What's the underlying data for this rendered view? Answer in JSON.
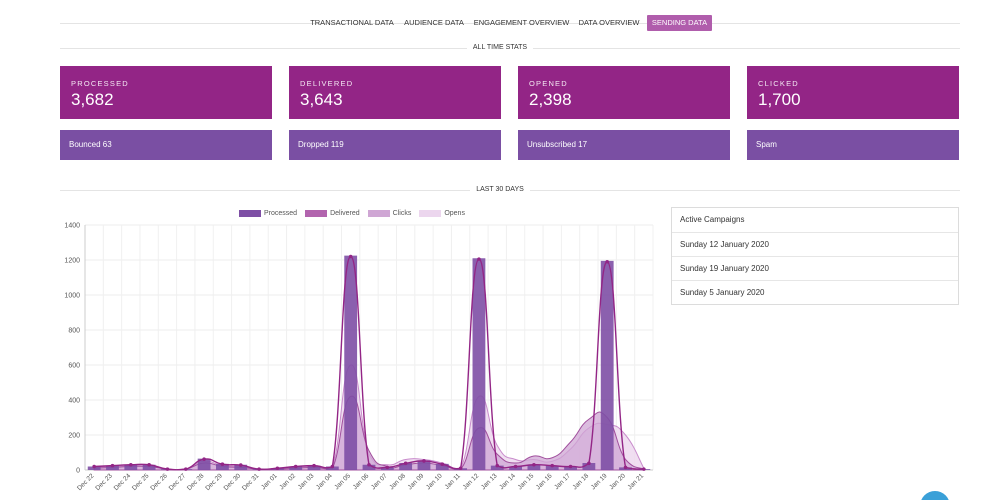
{
  "tabs": [
    {
      "label": "Transactional Data"
    },
    {
      "label": "Audience Data"
    },
    {
      "label": "Engagement Overview"
    },
    {
      "label": "Data Overview"
    },
    {
      "label": "Sending Data"
    }
  ],
  "active_tab": "Sending Data",
  "all_time": {
    "title": "All time stats",
    "stats": [
      {
        "label": "Processed",
        "value": "3,682"
      },
      {
        "label": "Delivered",
        "value": "3,643"
      },
      {
        "label": "Opened",
        "value": "2,398"
      },
      {
        "label": "Clicked",
        "value": "1,700"
      }
    ],
    "secondary": [
      {
        "label": "Bounced 63"
      },
      {
        "label": "Dropped 119"
      },
      {
        "label": "Unsubscribed 17"
      },
      {
        "label": "Spam"
      }
    ]
  },
  "last30": {
    "title": "Last 30 days"
  },
  "campaigns": {
    "header": "Active Campaigns",
    "items": [
      "Sunday 12 January 2020",
      "Sunday 19 January 2020",
      "Sunday 5 January 2020"
    ]
  },
  "colors": {
    "accent": "#932586",
    "secondary_card": "#7a4fa3",
    "active_tab": "#b05dac",
    "processed": "#7e4fa5",
    "delivered": "#b264ae",
    "clicks": "#cfa6d4",
    "opens": "#ecd6ee",
    "help_bubble": "#3aa0d8"
  },
  "chart_data": {
    "type": "bar",
    "categories": [
      "Dec 22",
      "Dec 23",
      "Dec 24",
      "Dec 25",
      "Dec 26",
      "Dec 27",
      "Dec 28",
      "Dec 29",
      "Dec 30",
      "Dec 31",
      "Jan 01",
      "Jan 02",
      "Jan 03",
      "Jan 04",
      "Jan 05",
      "Jan 06",
      "Jan 07",
      "Jan 08",
      "Jan 09",
      "Jan 10",
      "Jan 11",
      "Jan 12",
      "Jan 13",
      "Jan 14",
      "Jan 15",
      "Jan 16",
      "Jan 17",
      "Jan 18",
      "Jan 19",
      "Jan 20",
      "Jan 21"
    ],
    "ylim": [
      0,
      1400
    ],
    "yticks": [
      0,
      200,
      400,
      600,
      800,
      1000,
      1200,
      1400
    ],
    "grid": true,
    "legend_position": "top",
    "series": [
      {
        "name": "Processed",
        "kind": "bar",
        "color": "#7e4fa5",
        "values": [
          20,
          25,
          30,
          30,
          5,
          5,
          65,
          35,
          30,
          5,
          10,
          20,
          25,
          20,
          1225,
          30,
          15,
          40,
          55,
          35,
          10,
          1210,
          25,
          20,
          30,
          25,
          20,
          40,
          1195,
          15,
          5
        ]
      },
      {
        "name": "Delivered",
        "kind": "line",
        "color": "#932586",
        "values": [
          20,
          25,
          30,
          30,
          5,
          5,
          62,
          33,
          28,
          5,
          10,
          20,
          25,
          20,
          1220,
          30,
          15,
          38,
          52,
          33,
          10,
          1205,
          25,
          20,
          30,
          25,
          20,
          38,
          1190,
          15,
          5
        ]
      },
      {
        "name": "Clicks",
        "kind": "area",
        "color": "#cfa6d4",
        "values": [
          10,
          15,
          20,
          20,
          5,
          5,
          40,
          20,
          15,
          5,
          5,
          10,
          15,
          10,
          420,
          110,
          20,
          30,
          40,
          25,
          5,
          240,
          90,
          40,
          80,
          70,
          160,
          290,
          300,
          60,
          5
        ]
      },
      {
        "name": "Opens",
        "kind": "area",
        "color": "#ecd6ee",
        "values": [
          15,
          20,
          25,
          25,
          5,
          5,
          50,
          25,
          20,
          5,
          10,
          15,
          20,
          15,
          600,
          90,
          30,
          60,
          60,
          40,
          10,
          420,
          140,
          60,
          60,
          50,
          120,
          240,
          260,
          200,
          10
        ]
      }
    ]
  }
}
